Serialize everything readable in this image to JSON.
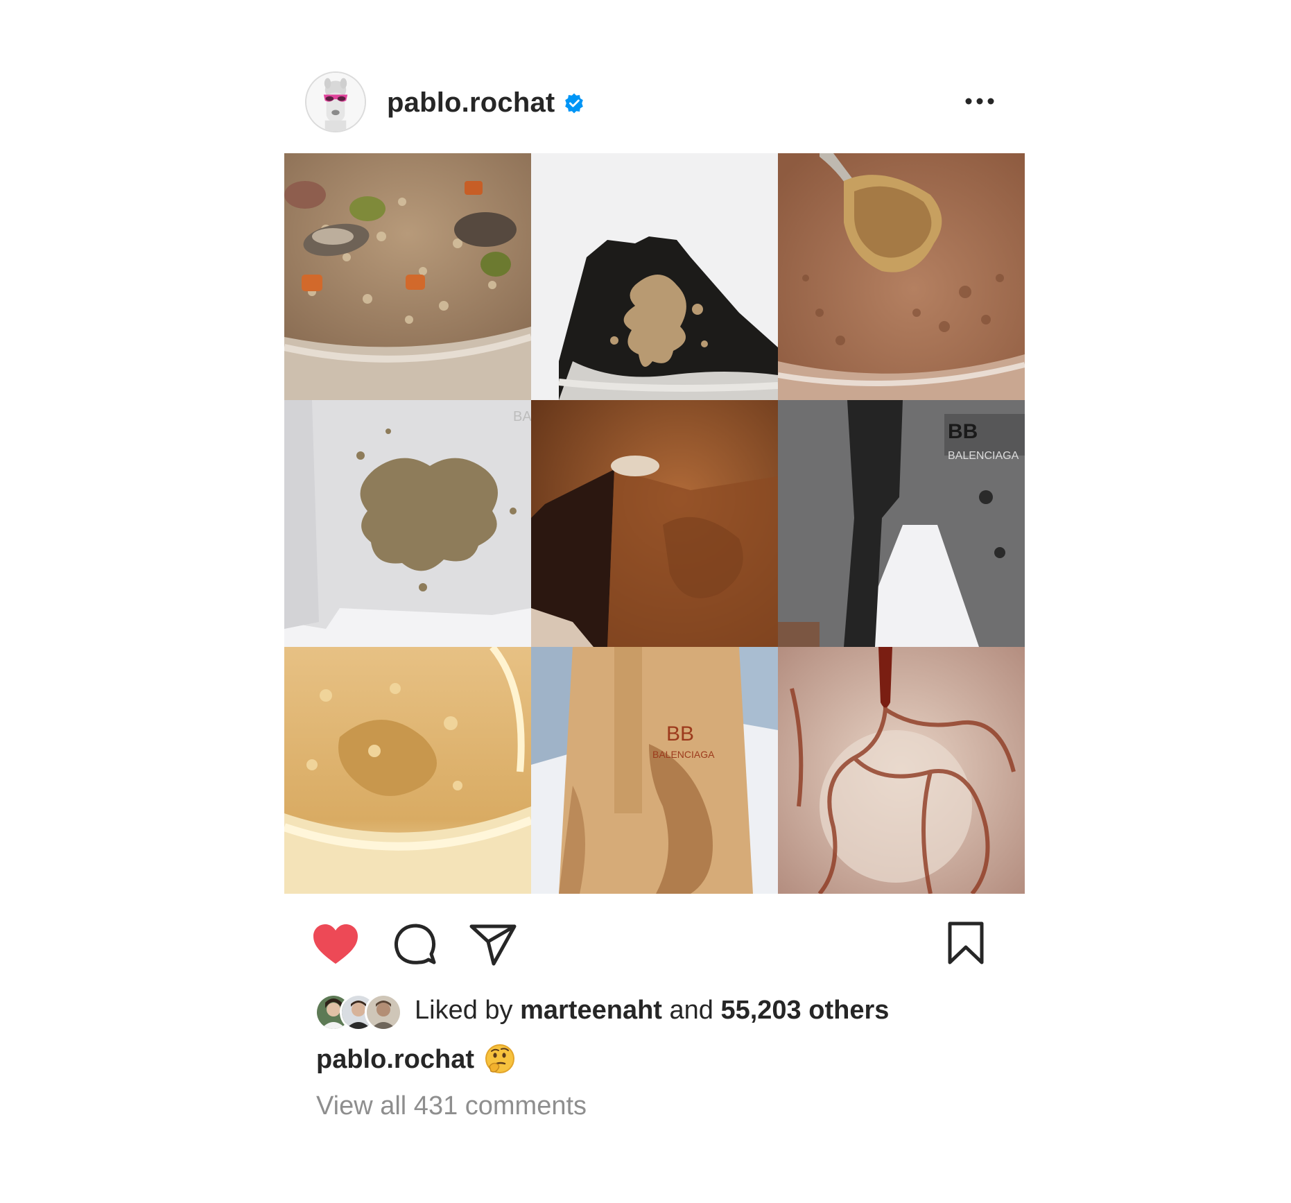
{
  "post": {
    "author": {
      "username": "pablo.rochat",
      "verified": true,
      "avatar_icon": "alpaca-with-pink-sunglasses"
    },
    "more_icon": "more-horizontal-icon",
    "images": [
      {
        "subject": "soup-with-mushrooms-and-barley"
      },
      {
        "subject": "black-sneaker-with-brown-splash"
      },
      {
        "subject": "chocolate-pudding-with-spoon"
      },
      {
        "subject": "grey-sweatshirt-with-brown-stain"
      },
      {
        "subject": "chocolate-frosted-cake-slice"
      },
      {
        "subject": "grey-sweatpants-with-dark-stain"
      },
      {
        "subject": "peanut-butter-jar"
      },
      {
        "subject": "tan-balenciaga-towel-with-stains"
      },
      {
        "subject": "latte-glass-with-caramel-drips"
      }
    ],
    "balenciaga_text": "BALENCIAGA",
    "actions": {
      "liked": true,
      "like_color": "#ed4956",
      "icons": [
        "heart-icon",
        "comment-icon",
        "share-icon",
        "bookmark-icon"
      ]
    },
    "likes": {
      "prefix": "Liked by ",
      "top_liker": "marteenaht",
      "middle": " and ",
      "others": "55,203 others"
    },
    "caption": {
      "username": "pablo.rochat",
      "emoji": "thinking-face"
    },
    "view_comments": "View all 431 comments"
  },
  "colors": {
    "text": "#262626",
    "secondary_text": "#8e8e8e",
    "verified_blue": "#0095f6"
  }
}
